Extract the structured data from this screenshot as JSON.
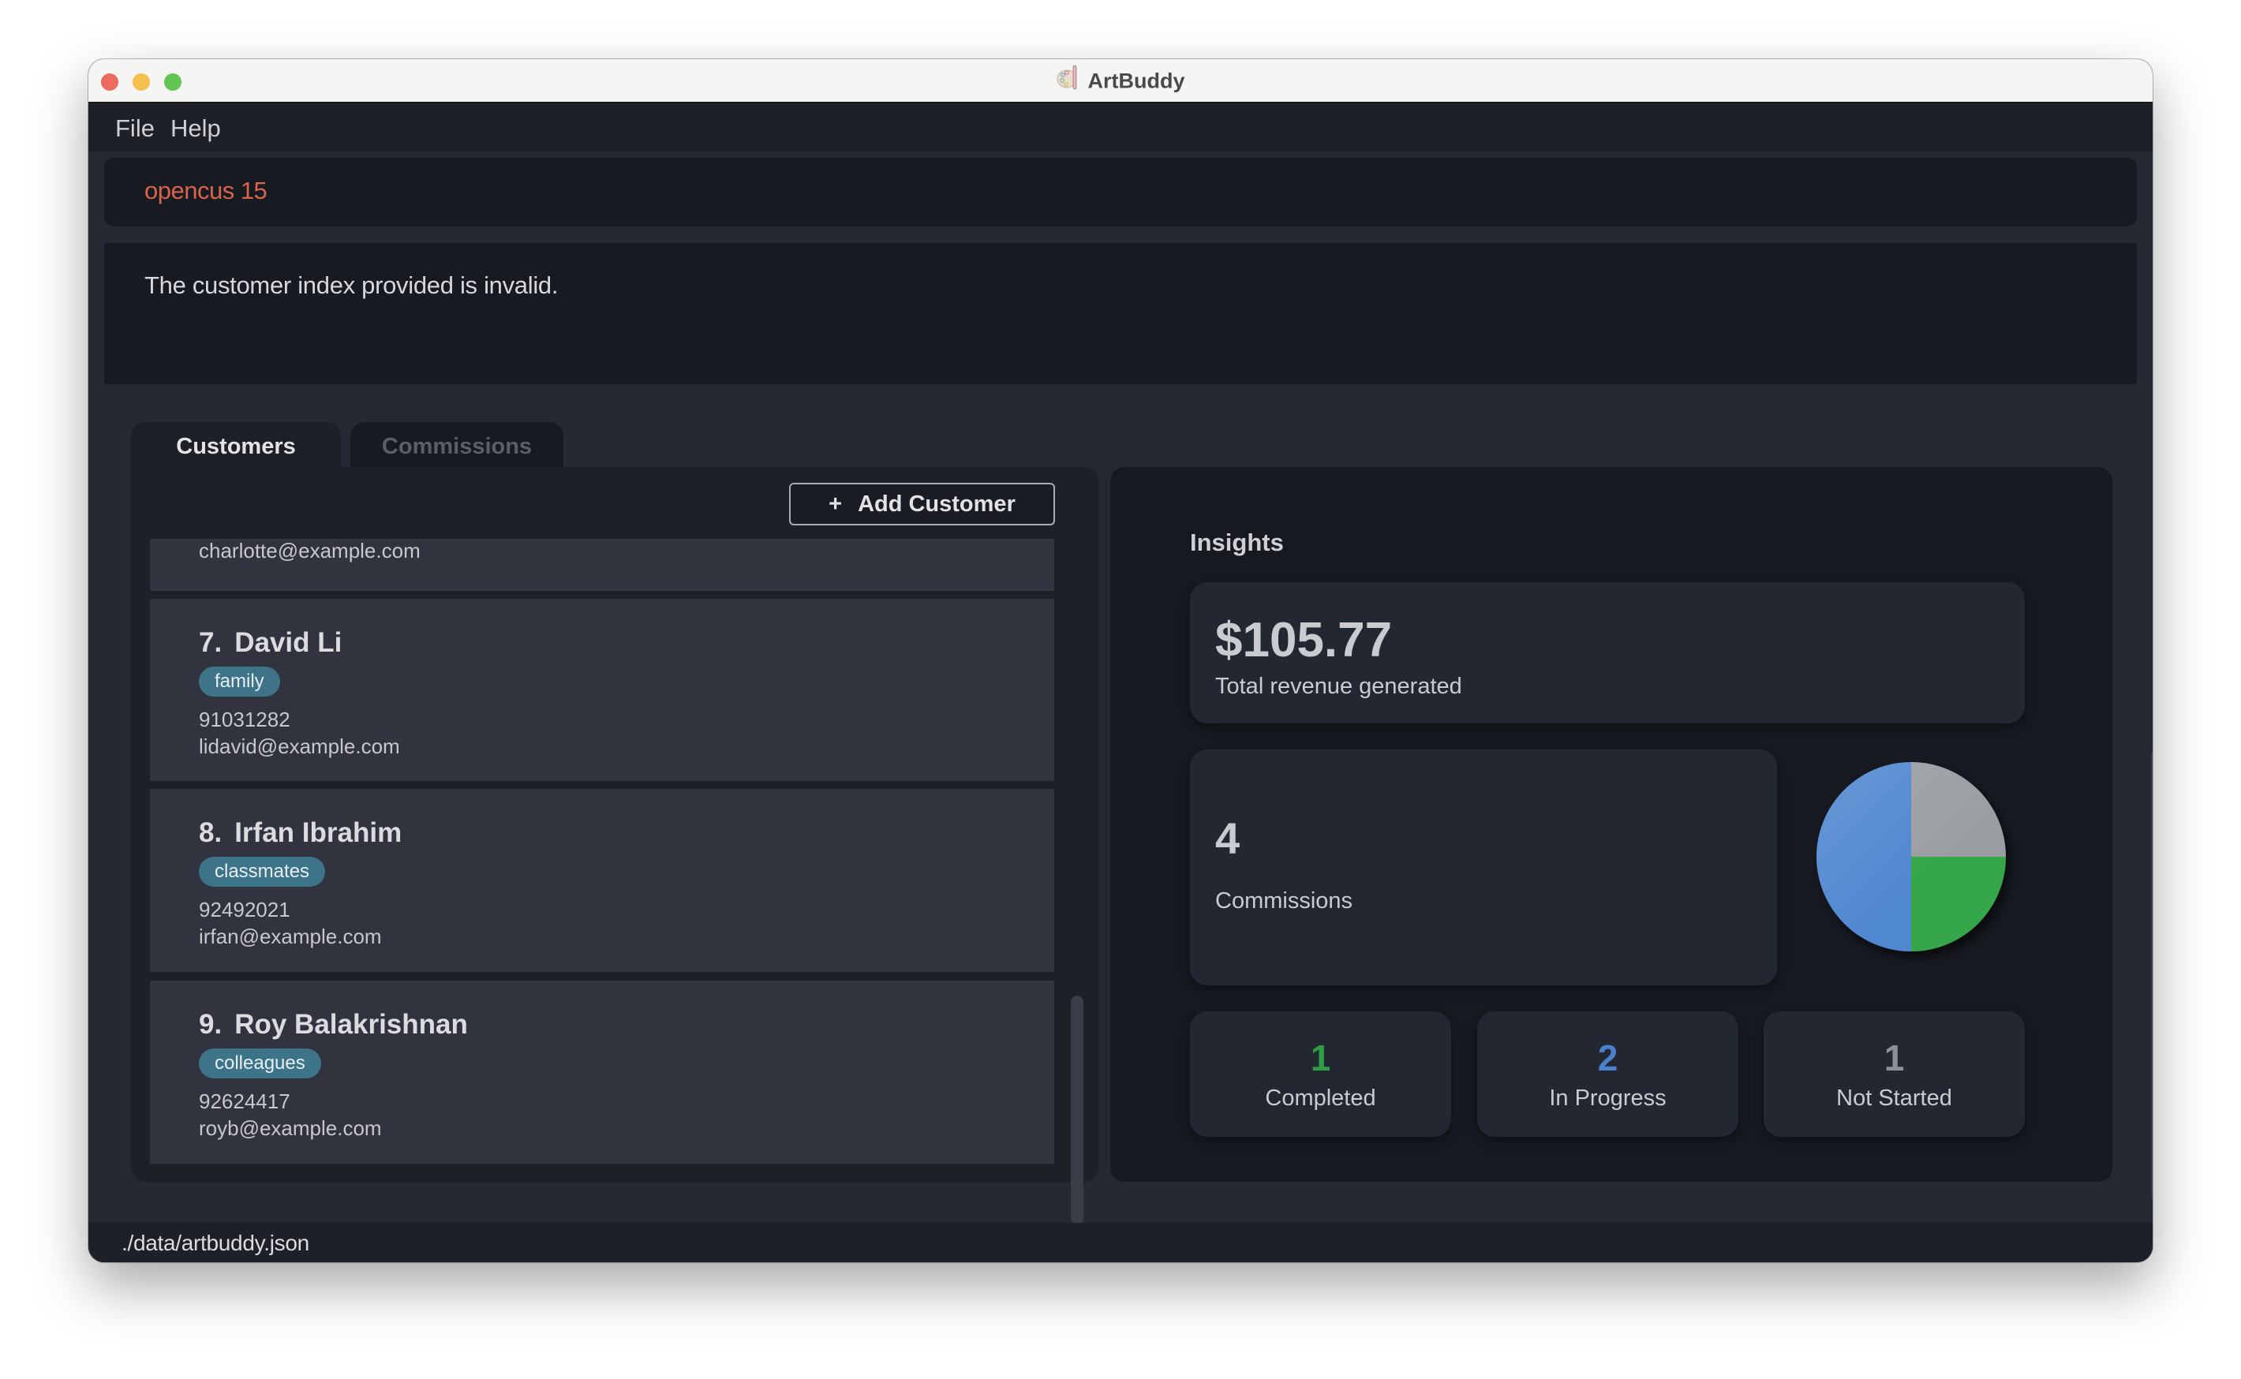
{
  "window": {
    "title": "ArtBuddy",
    "icon": "palette-icon"
  },
  "menu": {
    "items": [
      {
        "label": "File"
      },
      {
        "label": "Help"
      }
    ]
  },
  "command_box": {
    "value": "opencus 15",
    "text_color": "#d8644c"
  },
  "result_box": {
    "message": "The customer index provided is invalid."
  },
  "tabs": [
    {
      "label": "Customers",
      "active": true
    },
    {
      "label": "Commissions",
      "active": false
    }
  ],
  "customers_panel": {
    "add_button": {
      "icon": "plus-icon",
      "glyph": "+",
      "label": "Add Customer"
    },
    "partial_card": {
      "email": "charlotte@example.com"
    },
    "customers": [
      {
        "index": "7.",
        "name": "David Li",
        "tags": [
          "family"
        ],
        "phone": "91031282",
        "email": "lidavid@example.com"
      },
      {
        "index": "8.",
        "name": "Irfan Ibrahim",
        "tags": [
          "classmates"
        ],
        "phone": "92492021",
        "email": "irfan@example.com"
      },
      {
        "index": "9.",
        "name": "Roy Balakrishnan",
        "tags": [
          "colleagues"
        ],
        "phone": "92624417",
        "email": "royb@example.com"
      }
    ]
  },
  "insights": {
    "title": "Insights",
    "revenue": {
      "value": "$105.77",
      "label": "Total revenue generated"
    },
    "commissions": {
      "value": "4",
      "label": "Commissions"
    },
    "statuses": [
      {
        "value": "1",
        "label": "Completed",
        "color": "#2e9e44"
      },
      {
        "value": "2",
        "label": "In Progress",
        "color": "#4a80cc"
      },
      {
        "value": "1",
        "label": "Not Started",
        "color": "#8e9095"
      }
    ]
  },
  "chart_data": {
    "type": "pie",
    "title": "",
    "categories": [
      "Completed",
      "In Progress",
      "Not Started"
    ],
    "values": [
      1,
      2,
      1
    ],
    "colors": [
      "#36a64a",
      "#4f87d0",
      "#9a9da2"
    ],
    "start": "top, clockwise: Not Started, Completed, In Progress"
  },
  "status_bar": {
    "path": "./data/artbuddy.json"
  }
}
